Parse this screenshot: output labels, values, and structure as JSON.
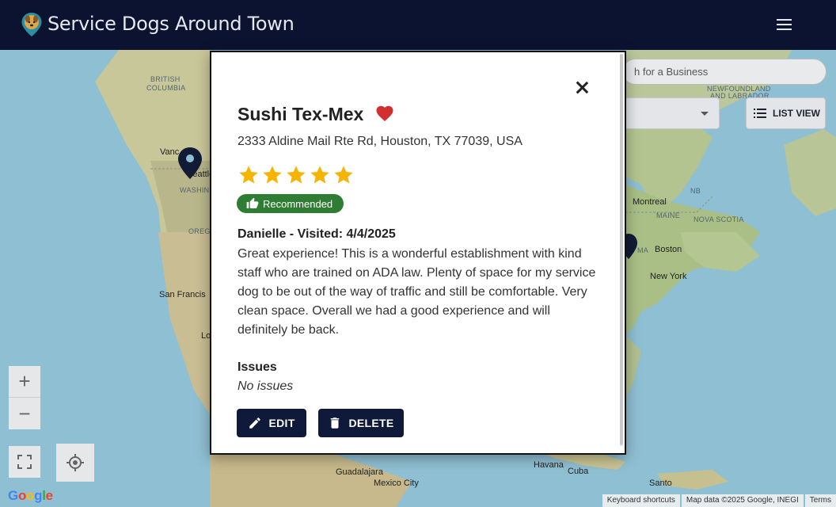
{
  "header": {
    "title": "Service Dogs Around Town",
    "logo_icon": "dog-pin-logo-icon",
    "menu_icon": "hamburger-menu-icon"
  },
  "map": {
    "search_placeholder": "h for a Business",
    "list_view_label": "LIST VIEW",
    "labels": [
      {
        "key": "british_columbia_1",
        "text": "BRITISH"
      },
      {
        "key": "british_columbia_2",
        "text": "COLUMBIA"
      },
      {
        "key": "vancouver",
        "text": "Vanc"
      },
      {
        "key": "seattle",
        "text": "Seattle"
      },
      {
        "key": "washington",
        "text": "WASHIN"
      },
      {
        "key": "oregon",
        "text": "OREG"
      },
      {
        "key": "san_francisco",
        "text": "San Francis"
      },
      {
        "key": "los_angeles",
        "text": "Lo"
      },
      {
        "key": "newfoundland_1",
        "text": "NEWFOUNDLAND"
      },
      {
        "key": "newfoundland_2",
        "text": "AND LABRADOR"
      },
      {
        "key": "nb",
        "text": "NB"
      },
      {
        "key": "montreal",
        "text": "Montreal"
      },
      {
        "key": "maine",
        "text": "MAINE"
      },
      {
        "key": "nova_scotia",
        "text": "NOVA SCOTIA"
      },
      {
        "key": "boston",
        "text": "Boston"
      },
      {
        "key": "ma",
        "text": "MA"
      },
      {
        "key": "new_york",
        "text": "New York"
      },
      {
        "key": "havana",
        "text": "Havana"
      },
      {
        "key": "cuba",
        "text": "Cuba"
      },
      {
        "key": "guadalajara",
        "text": "Guadalajara"
      },
      {
        "key": "mexico_city",
        "text": "Mexico City"
      },
      {
        "key": "santo",
        "text": "Santo"
      }
    ],
    "google_logo": "Google",
    "footer": {
      "shortcuts": "Keyboard shortcuts",
      "map_data": "Map data ©2025 Google, INEGI",
      "terms": "Terms"
    },
    "zoom_in_label": "+",
    "zoom_out_label": "−"
  },
  "modal": {
    "business_name": "Sushi Tex-Mex",
    "favorite_icon": "heart-icon",
    "favorite_color": "#d32f2f",
    "address": "2333 Aldine Mail Rte Rd, Houston, TX 77039, USA",
    "rating": 5,
    "rating_max": 5,
    "star_color": "#f5b400",
    "badge": {
      "label": "Recommended",
      "icon": "thumbs-up-icon",
      "color": "#2e7d32"
    },
    "review": {
      "author_line": "Danielle - Visited: 4/4/2025",
      "text": "Great experience! This is a wonderful establishment with kind staff who are trained on ADA law. Plenty of space for my service dog to be out of the way of traffic and still be comfortable. Very clean space. Overall we had a good experience and will definitely be back."
    },
    "issues": {
      "heading": "Issues",
      "text": "No issues"
    },
    "edit_label": "EDIT",
    "delete_label": "DELETE"
  }
}
